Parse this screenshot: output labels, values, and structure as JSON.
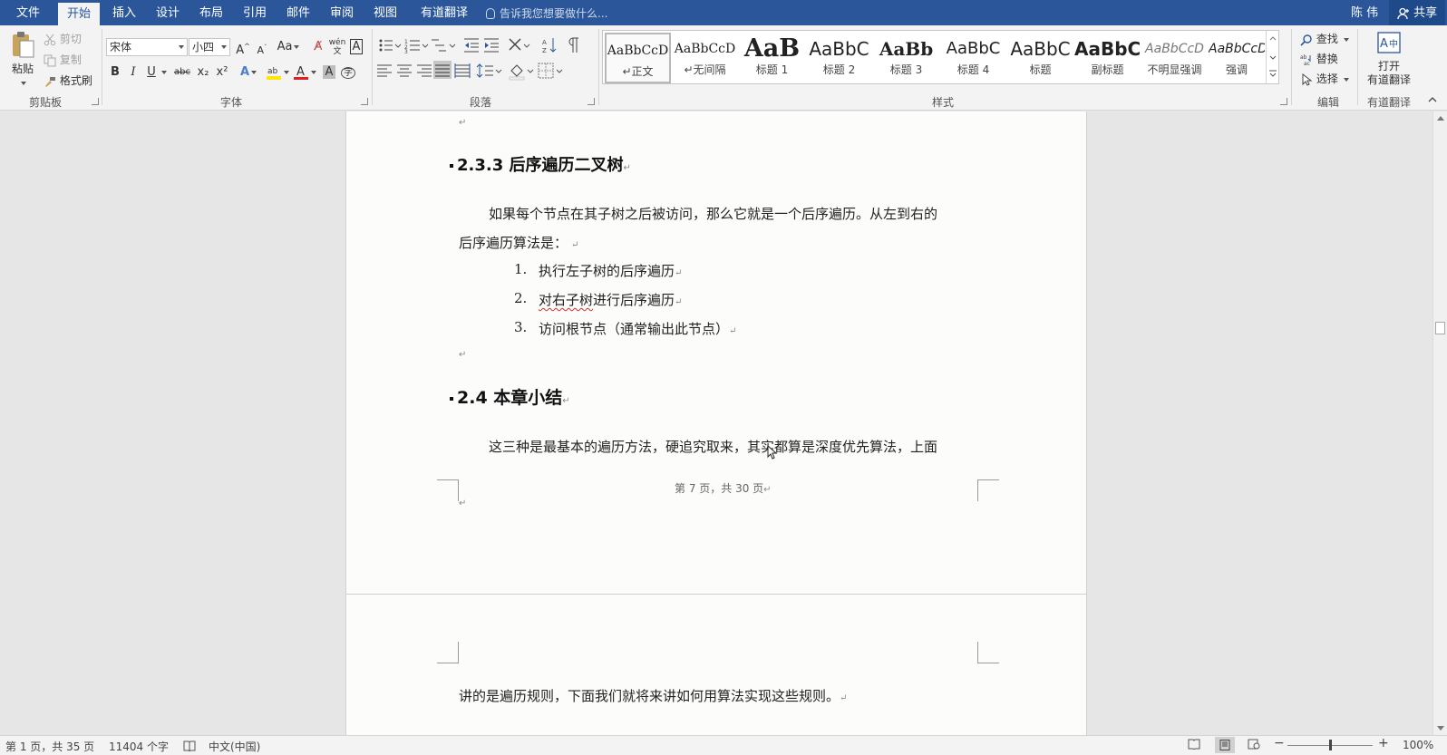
{
  "tabs": [
    {
      "label": "文件",
      "active": false
    },
    {
      "label": "开始",
      "active": true
    },
    {
      "label": "插入",
      "active": false
    },
    {
      "label": "设计",
      "active": false
    },
    {
      "label": "布局",
      "active": false
    },
    {
      "label": "引用",
      "active": false
    },
    {
      "label": "邮件",
      "active": false
    },
    {
      "label": "审阅",
      "active": false
    },
    {
      "label": "视图",
      "active": false
    },
    {
      "label": "有道翻译",
      "active": false
    }
  ],
  "tell_me": "告诉我您想要做什么...",
  "user_name": "陈 伟",
  "share_label": "共享",
  "ribbon": {
    "clipboard": {
      "label": "剪贴板",
      "paste": "粘贴",
      "cut": "剪切",
      "copy": "复制",
      "format_painter": "格式刷"
    },
    "font": {
      "label": "字体",
      "font_name": "宋体",
      "font_size": "小四",
      "case_label": "Aa",
      "bold": "B",
      "italic": "I",
      "underline": "U",
      "strike": "abc",
      "subscript": "x₂",
      "superscript": "x²",
      "font_color": "#e02020",
      "highlight_color": "#ffe600"
    },
    "paragraph": {
      "label": "段落"
    },
    "styles": {
      "label": "样式",
      "items": [
        {
          "sample": "AaBbCcD",
          "name": "↵正文",
          "selected": true
        },
        {
          "sample": "AaBbCcD",
          "name": "↵无间隔",
          "selected": false
        },
        {
          "sample": "AaB",
          "name": "标题 1",
          "selected": false
        },
        {
          "sample": "AaBbC",
          "name": "标题 2",
          "selected": false
        },
        {
          "sample": "AaBb",
          "name": "标题 3",
          "selected": false
        },
        {
          "sample": "AaBbC",
          "name": "标题 4",
          "selected": false
        },
        {
          "sample": "AaBbC",
          "name": "标题",
          "selected": false
        },
        {
          "sample": "AaBbC",
          "name": "副标题",
          "selected": false
        },
        {
          "sample": "AaBbCcD",
          "name": "不明显强调",
          "selected": false
        },
        {
          "sample": "AaBbCcD",
          "name": "强调",
          "selected": false
        }
      ]
    },
    "editing": {
      "label": "编辑",
      "find": "查找",
      "replace": "替换",
      "select": "选择"
    },
    "youdao": {
      "label": "有道翻译",
      "open_line1": "打开",
      "open_line2": "有道翻译"
    }
  },
  "document": {
    "heading_233": "2.3.3  后序遍历二叉树",
    "para1_line1": "如果每个节点在其子树之后被访问，那么它就是一个后序遍历。从左到右的",
    "para1_line2": "后序遍历算法是：",
    "list": [
      {
        "num": "1.",
        "text": "执行左子树的后序遍历"
      },
      {
        "num": "2.",
        "text_a": "对右子树",
        "text_b": "进行后序遍历"
      },
      {
        "num": "3.",
        "text": "访问根节点（通常输出此节点）"
      }
    ],
    "heading_24": "2.4  本章小结",
    "para2_line1": "这三种是最基本的遍历方法，硬追究取来，其实都算是深度优先算法，上面",
    "footer": "第 7 页，共 30 页",
    "para2_line2": "讲的是遍历规则，下面我们就将来讲如何用算法实现这些规则。",
    "para_mark": "↵"
  },
  "statusbar": {
    "page": "第 1 页，共 35 页",
    "words": "11404 个字",
    "language": "中文(中国)",
    "zoom": "100%"
  }
}
